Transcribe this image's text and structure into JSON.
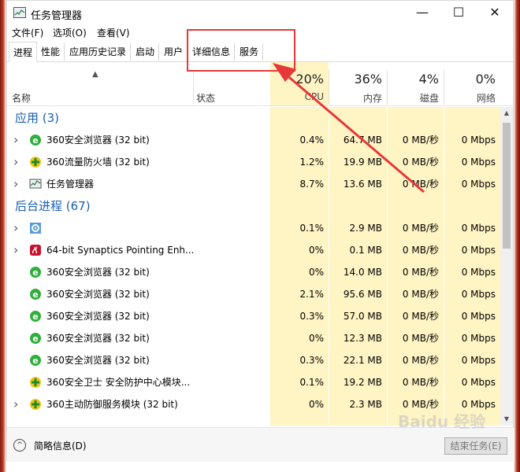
{
  "window": {
    "title": "任务管理器",
    "minimize": "—",
    "maximize": "☐",
    "close": "✕"
  },
  "menu": [
    "文件(F)",
    "选项(O)",
    "查看(V)"
  ],
  "tabs": [
    "进程",
    "性能",
    "应用历史记录",
    "启动",
    "用户",
    "详细信息",
    "服务"
  ],
  "headers": {
    "name": "名称",
    "status": "状态",
    "cpu": {
      "pct": "20%",
      "label": "CPU"
    },
    "mem": {
      "pct": "36%",
      "label": "内存"
    },
    "disk": {
      "pct": "4%",
      "label": "磁盘"
    },
    "net": {
      "pct": "0%",
      "label": "网络"
    }
  },
  "groups": {
    "apps": "应用 (3)",
    "bg": "后台进程 (67)"
  },
  "apps": [
    {
      "name": "360安全浏览器 (32 bit)",
      "icon": "ie-browser-icon",
      "cpu": "0.4%",
      "mem": "64.7 MB",
      "disk": "0 MB/秒",
      "net": "0 Mbps"
    },
    {
      "name": "360流量防火墙 (32 bit)",
      "icon": "shield-plus-icon",
      "cpu": "1.2%",
      "mem": "19.9 MB",
      "disk": "0 MB/秒",
      "net": "0 Mbps"
    },
    {
      "name": "任务管理器",
      "icon": "task-manager-icon",
      "cpu": "8.7%",
      "mem": "13.6 MB",
      "disk": "0 MB/秒",
      "net": "0 Mbps"
    }
  ],
  "background": [
    {
      "name": "",
      "icon": "gear-icon",
      "cpu": "0.1%",
      "mem": "2.9 MB",
      "disk": "0 MB/秒",
      "net": "0 Mbps",
      "expand": true
    },
    {
      "name": "64-bit Synaptics Pointing Enh...",
      "icon": "synaptics-icon",
      "cpu": "0%",
      "mem": "0.1 MB",
      "disk": "0 MB/秒",
      "net": "0 Mbps",
      "expand": true
    },
    {
      "name": "360安全浏览器 (32 bit)",
      "icon": "ie-browser-icon",
      "cpu": "0%",
      "mem": "14.0 MB",
      "disk": "0 MB/秒",
      "net": "0 Mbps"
    },
    {
      "name": "360安全浏览器 (32 bit)",
      "icon": "ie-browser-icon",
      "cpu": "2.1%",
      "mem": "95.6 MB",
      "disk": "0 MB/秒",
      "net": "0 Mbps"
    },
    {
      "name": "360安全浏览器 (32 bit)",
      "icon": "ie-browser-icon",
      "cpu": "0.3%",
      "mem": "57.0 MB",
      "disk": "0 MB/秒",
      "net": "0 Mbps"
    },
    {
      "name": "360安全浏览器 (32 bit)",
      "icon": "ie-browser-icon",
      "cpu": "0%",
      "mem": "12.3 MB",
      "disk": "0 MB/秒",
      "net": "0 Mbps"
    },
    {
      "name": "360安全浏览器 (32 bit)",
      "icon": "ie-browser-icon",
      "cpu": "0.3%",
      "mem": "22.1 MB",
      "disk": "0 MB/秒",
      "net": "0 Mbps"
    },
    {
      "name": "360安全卫士 安全防护中心模块...",
      "icon": "shield-plus-icon",
      "cpu": "0.1%",
      "mem": "19.2 MB",
      "disk": "0 MB/秒",
      "net": "0 Mbps"
    },
    {
      "name": "360主动防御服务模块 (32 bit)",
      "icon": "shield-plus-icon",
      "cpu": "0%",
      "mem": "2.3 MB",
      "disk": "0 MB/秒",
      "net": "0 Mbps",
      "expand": true
    }
  ],
  "footer": {
    "fewer": "简略信息(D)",
    "end_task": "结束任务(E)"
  },
  "watermark": "Baidu 经验",
  "colors": {
    "group": "#1a5fb4",
    "cpu_fill": "#fff4c4",
    "annotation": "#e63838"
  }
}
